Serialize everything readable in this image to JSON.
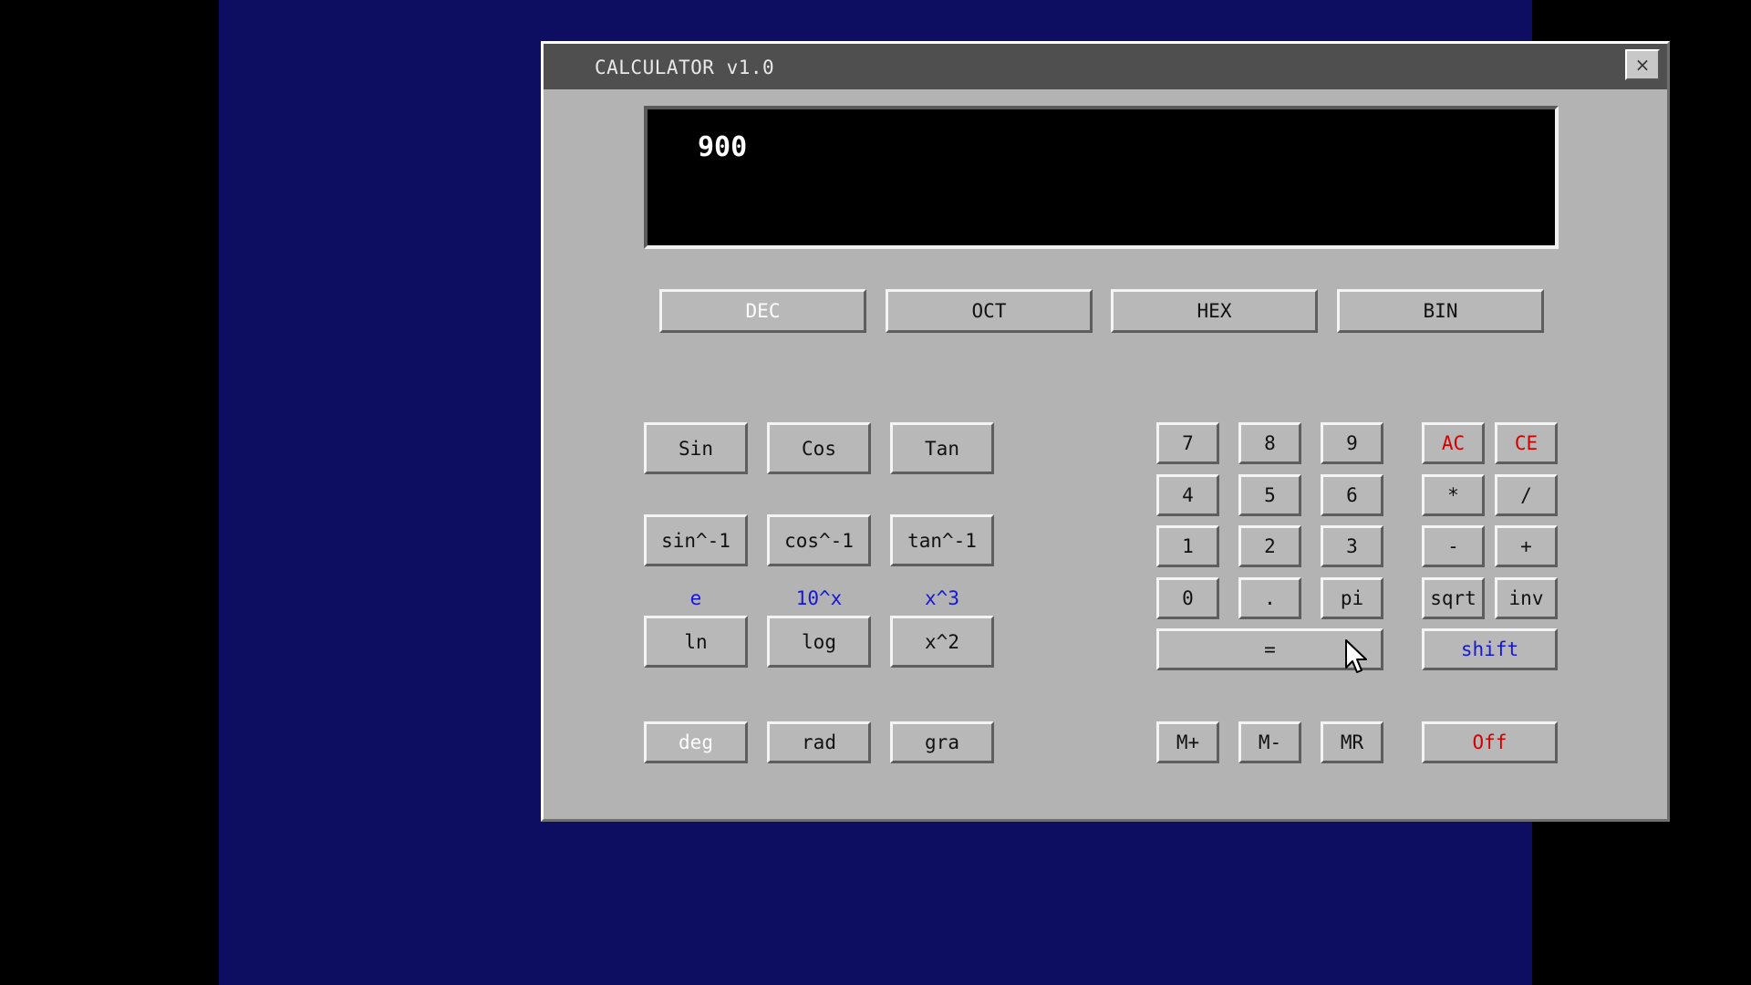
{
  "window": {
    "title": "CALCULATOR v1.0",
    "close_label": "×"
  },
  "display": {
    "value": "900"
  },
  "base_modes": [
    "DEC",
    "OCT",
    "HEX",
    "BIN"
  ],
  "active_base": "DEC",
  "trig": {
    "row1": [
      "Sin",
      "Cos",
      "Tan"
    ],
    "row2": [
      "sin^-1",
      "cos^-1",
      "tan^-1"
    ],
    "shift_labels": [
      "e",
      "10^x",
      "x^3"
    ],
    "row3": [
      "ln",
      "log",
      "x^2"
    ],
    "angle_modes": [
      "deg",
      "rad",
      "gra"
    ]
  },
  "active_angle": "deg",
  "keypad": {
    "digits": [
      "7",
      "8",
      "9",
      "4",
      "5",
      "6",
      "1",
      "2",
      "3",
      "0",
      ".",
      "pi"
    ],
    "equals": "=",
    "memory": [
      "M+",
      "M-",
      "MR"
    ]
  },
  "ops": {
    "ac": "AC",
    "ce": "CE",
    "mul": "*",
    "div": "/",
    "sub": "-",
    "add": "+",
    "sqrt": "sqrt",
    "inv": "inv",
    "shift": "shift",
    "off": "Off"
  },
  "colors": {
    "desktop": "#0d0d62",
    "window": "#b3b3b3",
    "titlebar": "#4f4f4f",
    "red": "#d40000",
    "blue": "#1616d8"
  }
}
